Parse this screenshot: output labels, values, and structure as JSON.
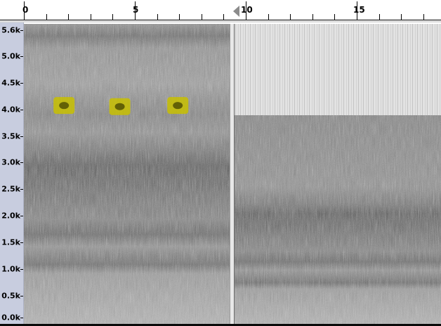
{
  "ruler": {
    "labels": [
      "0",
      "5",
      "10",
      "15"
    ],
    "marker_icon": "playhead-triangle-icon"
  },
  "freq_axis": {
    "labels": [
      "5.6k",
      "5.0k",
      "4.5k",
      "4.0k",
      "3.5k",
      "3.0k",
      "2.5k",
      "2.0k",
      "1.5k",
      "1.0k",
      "0.5k",
      "0.0k"
    ]
  },
  "spectrogram": {
    "view_time_seconds": [
      0,
      18.7
    ],
    "view_freq_hz": [
      0,
      5600
    ],
    "clip_boundary_seconds": 9.4,
    "right_clip_cutoff_hz": 3850,
    "highlight_color": "#c8c000",
    "highlights": [
      {
        "time_seconds": 1.8,
        "freq_hz": 4080
      },
      {
        "time_seconds": 4.3,
        "freq_hz": 4060
      },
      {
        "time_seconds": 6.9,
        "freq_hz": 4080
      }
    ]
  }
}
